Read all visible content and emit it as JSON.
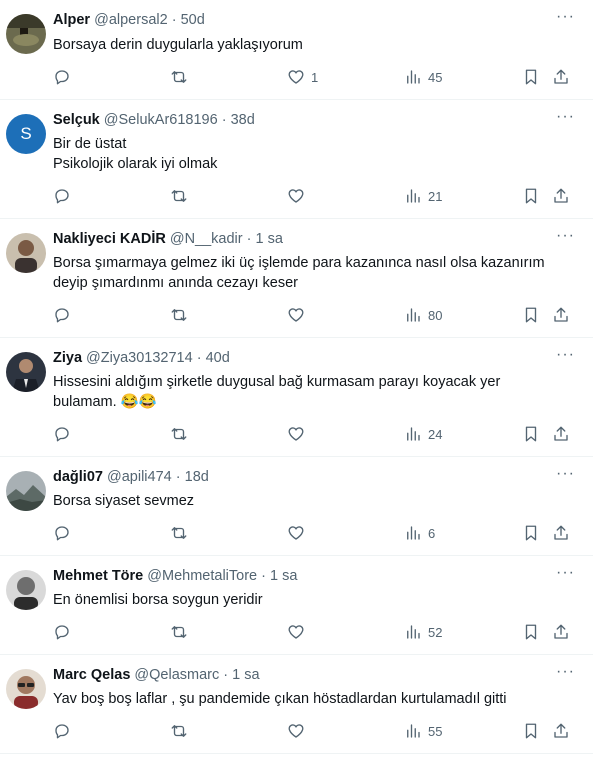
{
  "tweets": [
    {
      "name": "Alper",
      "handle": "@alpersal2",
      "time": "50d",
      "lines": [
        "Borsaya derin duygularla yaklaşıyorum"
      ],
      "likes": "1",
      "views": "45",
      "avatar": "photo-dark"
    },
    {
      "name": "Selçuk",
      "handle": "@SelukAr618196",
      "time": "38d",
      "lines": [
        "Bir de üstat",
        "Psikolojik olarak iyi olmak"
      ],
      "likes": "",
      "views": "21",
      "avatar": "letter",
      "avatar_letter": "S"
    },
    {
      "name": "Nakliyeci KADİR",
      "handle": "@N__kadir",
      "time": "1 sa",
      "lines": [
        "Borsa şımarmaya gelmez iki üç işlemde para kazanınca nasıl olsa kazanırım",
        "deyip şımardınmı anında cezayı keser"
      ],
      "likes": "",
      "views": "80",
      "avatar": "photo-man"
    },
    {
      "name": "Ziya",
      "handle": "@Ziya30132714",
      "time": "40d",
      "lines": [
        "Hissesini aldığım şirketle duygusal bağ kurmasam parayı koyacak yer",
        "bulamam. 😂😂"
      ],
      "likes": "",
      "views": "24",
      "avatar": "photo-suit"
    },
    {
      "name": "dağli07",
      "handle": "@apili474",
      "time": "18d",
      "lines": [
        "Borsa siyaset sevmez"
      ],
      "likes": "",
      "views": "6",
      "avatar": "photo-landscape"
    },
    {
      "name": "Mehmet Töre",
      "handle": "@MehmetaliTore",
      "time": "1 sa",
      "lines": [
        "En önemlisi borsa soygun yeridir"
      ],
      "likes": "",
      "views": "52",
      "avatar": "photo-bw"
    },
    {
      "name": "Marc Qelas",
      "handle": "@Qelasmarc",
      "time": "1 sa",
      "lines": [
        "Yav boş boş laflar , şu pandemide çıkan höstadlardan kurtulamadıl gitti"
      ],
      "likes": "",
      "views": "55",
      "avatar": "photo-glasses"
    }
  ],
  "icons": {
    "reply": "reply-icon",
    "retweet": "retweet-icon",
    "like": "heart-icon",
    "views": "views-icon",
    "bookmark": "bookmark-icon",
    "share": "share-icon",
    "more": "more-icon"
  },
  "colors": {
    "text": "#0f1419",
    "muted": "#536471",
    "divider": "#eff3f4",
    "avatar_letter_bg": "#1d6fb8"
  }
}
